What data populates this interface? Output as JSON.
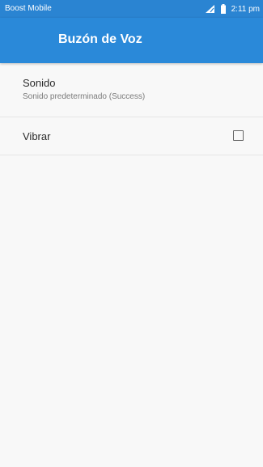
{
  "status_bar": {
    "carrier": "Boost Mobile",
    "time": "2:11 pm",
    "icons": [
      "signal-icon",
      "battery-icon"
    ]
  },
  "app_bar": {
    "title": "Buzón de Voz"
  },
  "preferences": {
    "sound": {
      "title": "Sonido",
      "summary": "Sonido predeterminado (Success)"
    },
    "vibrate": {
      "title": "Vibrar",
      "checked": false
    }
  },
  "colors": {
    "status_bar": "#2a84d2",
    "app_bar": "#2a89d9",
    "background": "#f8f8f8"
  }
}
